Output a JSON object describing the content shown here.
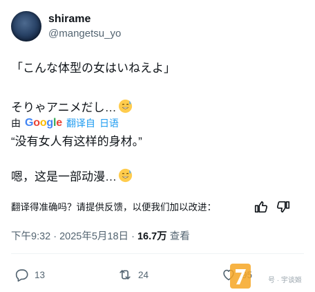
{
  "author": {
    "display_name": "shirame",
    "handle": "@mangetsu_yo"
  },
  "post": {
    "line1": "「こんな体型の女はいねえよ」",
    "line2": "そりゃアニメだし…",
    "emoji": "sweat-smile-emoji",
    "translated_by_prefix": "由",
    "translated_by_brand": "Google",
    "translated_from": "翻译自",
    "source_language": "日语",
    "translation_line1": "“没有女人有这样的身材。”",
    "translation_line2": "嗯，这是一部动漫…"
  },
  "feedback": {
    "question": "翻译得准确吗？请提供反馈，以便我们加以改进："
  },
  "meta": {
    "timestamp": "下午9:32 · 2025年5月18日 · ",
    "views_count": "16.7万",
    "views_label": " 查看"
  },
  "actions": {
    "reply_count": "13",
    "retweet_count": "24",
    "like_count": "95"
  },
  "watermark": {
    "text": "号 · 宇谈姬"
  },
  "colors": {
    "link": "#1d9bf0",
    "secondary": "#536471",
    "primary_text": "#0f1419"
  }
}
